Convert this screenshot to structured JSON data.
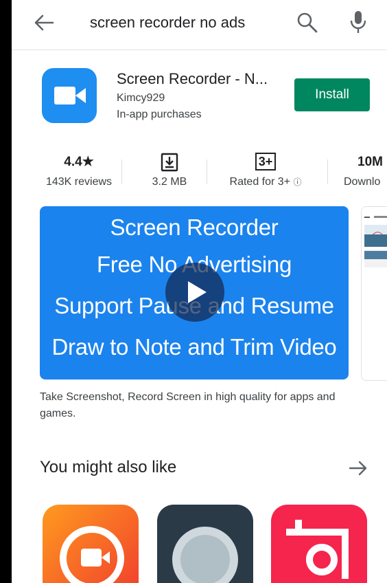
{
  "search": {
    "query": "screen recorder no ads"
  },
  "app": {
    "title": "Screen Recorder - N...",
    "developer": "Kimcy929",
    "in_app": "In-app purchases",
    "install_label": "Install"
  },
  "stats": {
    "rating": "4.4",
    "star": "★",
    "reviews": "143K reviews",
    "size": "3.2 MB",
    "age_badge": "3+",
    "rated": "Rated for 3+",
    "info": "ⓘ",
    "downloads": "10M",
    "downloads_label": "Downlo"
  },
  "screenshot": {
    "lines": [
      "Screen Recorder",
      "Free No Advertising",
      "Support Pause and Resume",
      "Draw to Note and Trim Video"
    ]
  },
  "description": "Take Screenshot, Record Screen in high quality for apps and games.",
  "suggestions": {
    "heading": "You might also like",
    "colors": {
      "install": "#01875f",
      "app_icon": "#1e8ef0"
    }
  }
}
